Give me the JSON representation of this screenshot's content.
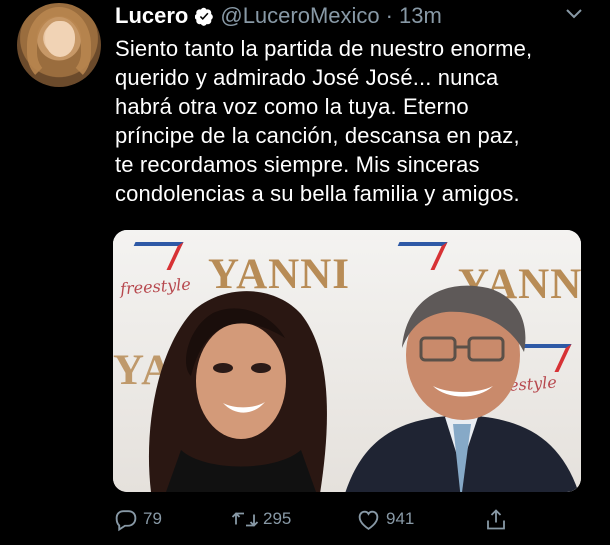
{
  "tweet": {
    "display_name": "Lucero",
    "handle": "@LuceroMexico",
    "separator": "·",
    "time": "13m",
    "text_lines": [
      "Siento tanto la partida de nuestro enorme,",
      "querido y admirado José José... nunca",
      "habrá otra voz como la tuya. Eterno",
      "príncipe de la canción, descansa en paz,",
      "te recordamos siempre. Mis sinceras",
      "condolencias a su bella familia y amigos."
    ]
  },
  "media": {
    "backdrop_texts": [
      "YANNI",
      "YANNI",
      "YA",
      "freestyle",
      "freestyle"
    ]
  },
  "actions": {
    "reply_count": "79",
    "retweet_count": "295",
    "like_count": "941"
  },
  "icons": {
    "verified": "verified-badge",
    "caret": "chevron-down-icon",
    "reply": "reply-icon",
    "retweet": "retweet-icon",
    "like": "heart-icon",
    "share": "share-icon"
  },
  "colors": {
    "background": "#000000",
    "text": "#ffffff",
    "secondary": "#8899a6",
    "verified": "#ffffff"
  }
}
